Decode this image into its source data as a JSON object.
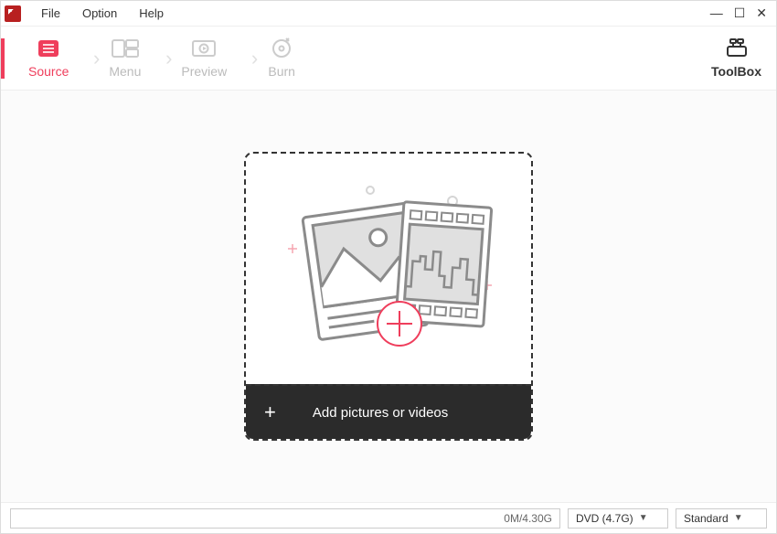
{
  "menubar": {
    "file": "File",
    "option": "Option",
    "help": "Help"
  },
  "steps": {
    "source": "Source",
    "menu": "Menu",
    "preview": "Preview",
    "burn": "Burn"
  },
  "toolbox": {
    "label": "ToolBox"
  },
  "dropzone": {
    "add_label": "Add pictures or videos"
  },
  "statusbar": {
    "capacity": "0M/4.30G",
    "disc_type": "DVD (4.7G)",
    "quality": "Standard"
  }
}
